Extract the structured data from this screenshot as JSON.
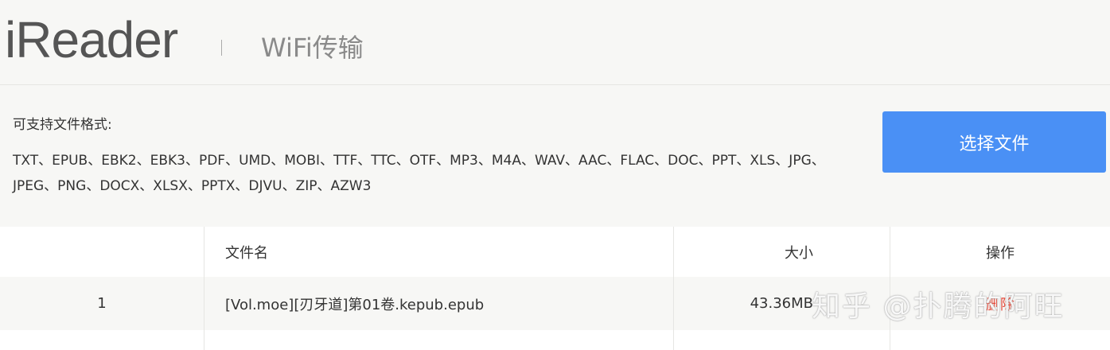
{
  "header": {
    "logo": "iReader",
    "divider": "|",
    "title": "WiFi传输"
  },
  "formats": {
    "label": "可支持文件格式:",
    "list": "TXT、EPUB、EBK2、EBK3、PDF、UMD、MOBI、TTF、TTC、OTF、MP3、M4A、WAV、AAC、FLAC、DOC、PPT、XLS、JPG、JPEG、PNG、DOCX、XLSX、PPTX、DJVU、ZIP、AZW3"
  },
  "select_button": {
    "label": "选择文件"
  },
  "table": {
    "headers": {
      "index": "",
      "name": "文件名",
      "size": "大小",
      "op": "操作"
    },
    "rows": [
      {
        "index": "1",
        "name": "[Vol.moe][刃牙道]第01卷.kepub.epub",
        "size": "43.36MB",
        "op": "删除"
      }
    ]
  },
  "watermark": "知乎 @扑腾的阿旺",
  "colors": {
    "accent": "#4a90f5",
    "delete": "#e64b3c",
    "background": "#f7f7f5"
  }
}
